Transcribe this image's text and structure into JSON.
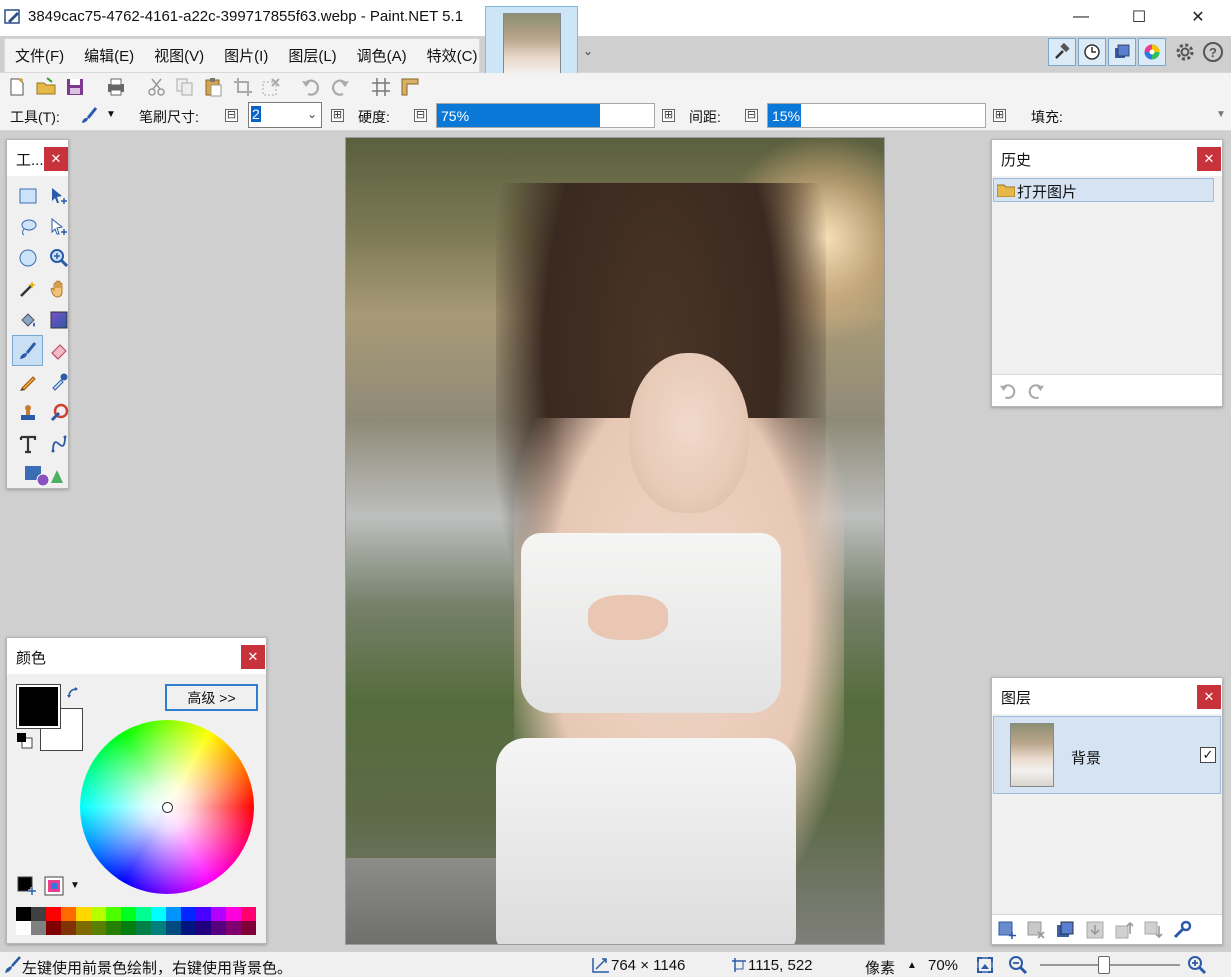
{
  "window": {
    "title": "3849cac75-4762-4161-a22c-399717855f63.webp - Paint.NET 5.1",
    "minimize": "—",
    "maximize": "☐",
    "close": "✕"
  },
  "menu": [
    "文件(F)",
    "编辑(E)",
    "视图(V)",
    "图片(I)",
    "图层(L)",
    "调色(A)",
    "特效(C)"
  ],
  "tab_dropdown": "⌄",
  "help_label": "?",
  "options": {
    "tool_label": "工具(T):",
    "brush_size_label": "笔刷尺寸:",
    "brush_size_value": "2",
    "hardness_label": "硬度:",
    "hardness_value": "75%",
    "hardness_fraction": 0.75,
    "spacing_label": "间距:",
    "spacing_value": "15%",
    "spacing_fraction": 0.15,
    "fill_label": "填充:",
    "minus": "⊟",
    "plus": "⊞"
  },
  "tools_panel": {
    "title": "工...",
    "close": "✕"
  },
  "history_panel": {
    "title": "历史",
    "close": "✕",
    "items": [
      "打开图片"
    ]
  },
  "layers_panel": {
    "title": "图层",
    "close": "✕",
    "layers": [
      {
        "name": "背景",
        "visible": "✓"
      }
    ]
  },
  "colors_panel": {
    "title": "颜色",
    "close": "✕",
    "advanced_label": "高级 >>",
    "primary": "#000000",
    "secondary": "#ffffff",
    "palette_top": [
      "#000000",
      "#404040",
      "#ff0000",
      "#ff6a00",
      "#ffd800",
      "#b6ff00",
      "#4cff00",
      "#00ff21",
      "#00ff90",
      "#00ffff",
      "#0094ff",
      "#0026ff",
      "#4800ff",
      "#b200ff",
      "#ff00dc",
      "#ff006e"
    ],
    "palette_bottom": [
      "#ffffff",
      "#808080",
      "#7f0000",
      "#7f3300",
      "#7f6a00",
      "#5b7f00",
      "#267f00",
      "#007f0e",
      "#007f46",
      "#007f7f",
      "#004a7f",
      "#00137f",
      "#21007f",
      "#57007f",
      "#7f006e",
      "#7f0037"
    ]
  },
  "status": {
    "hint": "左键使用前景色绘制，右键使用背景色。",
    "image_size": "764 × 1146",
    "cursor_pos": "1115, 522",
    "unit": "像素",
    "unit_arrow": "▲",
    "zoom": "70%"
  }
}
